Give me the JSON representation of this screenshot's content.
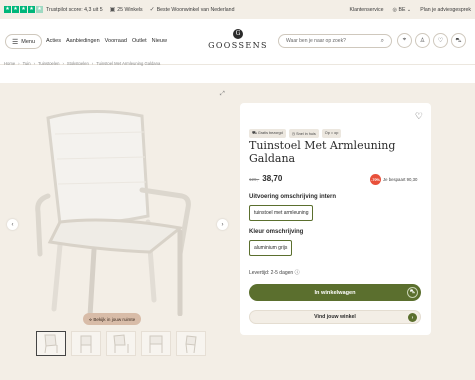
{
  "topbar": {
    "trustpilot_text": "Trustpilot score: 4,3 uit 5",
    "stores_text": "25 Winkels",
    "best_store_text": "Beste Woonwinkel van Nederland",
    "customer_service": "Klantenservice",
    "country": "BE",
    "appointment": "Plan je adviesgesprek"
  },
  "header": {
    "menu_label": "Menu",
    "nav": [
      "Acties",
      "Aanbiedingen",
      "Voorraad",
      "Outlet",
      "Nieuw"
    ],
    "logo_mark": "G",
    "logo_text": "GOOSSENS",
    "search_placeholder": "Waar ben je naar op zoek?",
    "icons": [
      "location-icon",
      "user-icon",
      "heart-icon",
      "cart-icon"
    ]
  },
  "breadcrumb": [
    "Home",
    "Tuin",
    "Tuinstoelen",
    "Stokstoelen",
    "Tuinstoel Met Armleuning Galdana"
  ],
  "gallery": {
    "ar_button": "Bekijk in jouw ruimte",
    "thumbnail_count": 5
  },
  "product": {
    "tags": [
      "Gratis bezorgd",
      "Snel in huis",
      "Op = op"
    ],
    "title": "Tuinstoel Met Armleuning Galdana",
    "old_price": "129,-",
    "price": "38,70",
    "discount_badge": "-70%",
    "discount_text": "Je bespaart 90,30",
    "variant_label": "Uitvoering omschrijving intern",
    "variant_value": "tuinstoel met armleuning",
    "color_label": "Kleur omschrijving",
    "color_value": "aluminium grijs",
    "delivery": "Levertijd: 2-5 dagen",
    "cart_button": "In winkelwagen",
    "store_button": "Vind jouw winkel"
  },
  "colors": {
    "accent_green": "#5b6f2e",
    "beige_bg": "#f3eee6",
    "discount_red": "#e8503a",
    "trustpilot_green": "#00b67a"
  }
}
